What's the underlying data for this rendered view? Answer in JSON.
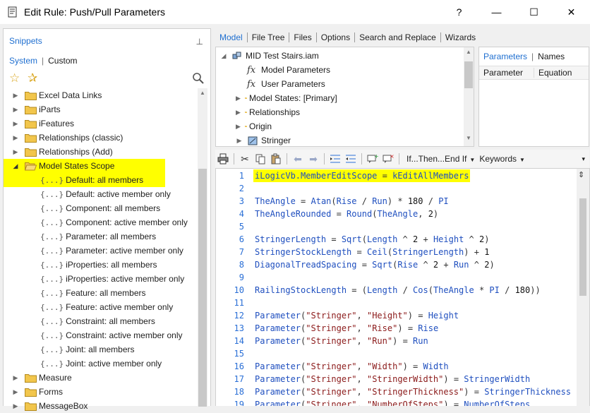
{
  "window": {
    "title": "Edit Rule: Push/Pull Parameters",
    "help_label": "?",
    "minimize_label": "—",
    "maximize_label": "☐",
    "close_label": "✕"
  },
  "snippets": {
    "header": "Snippets",
    "tab_system": "System",
    "tab_custom": "Custom",
    "items": [
      {
        "label": "Excel Data Links",
        "type": "folder",
        "expanded": false
      },
      {
        "label": "iParts",
        "type": "folder",
        "expanded": false
      },
      {
        "label": "iFeatures",
        "type": "folder",
        "expanded": false
      },
      {
        "label": "Relationships (classic)",
        "type": "folder",
        "expanded": false
      },
      {
        "label": "Relationships (Add)",
        "type": "folder",
        "expanded": false
      },
      {
        "label": "Model States Scope",
        "type": "folder",
        "expanded": true,
        "highlighted": true
      },
      {
        "label": "Default: all members",
        "type": "snippet",
        "highlighted": true
      },
      {
        "label": "Default: active member only",
        "type": "snippet"
      },
      {
        "label": "Component: all members",
        "type": "snippet"
      },
      {
        "label": "Component: active member only",
        "type": "snippet"
      },
      {
        "label": "Parameter: all members",
        "type": "snippet"
      },
      {
        "label": "Parameter: active member only",
        "type": "snippet"
      },
      {
        "label": "iProperties: all members",
        "type": "snippet"
      },
      {
        "label": "iProperties: active member only",
        "type": "snippet"
      },
      {
        "label": "Feature: all members",
        "type": "snippet"
      },
      {
        "label": "Feature: active member only",
        "type": "snippet"
      },
      {
        "label": "Constraint: all members",
        "type": "snippet"
      },
      {
        "label": "Constraint: active member only",
        "type": "snippet"
      },
      {
        "label": "Joint: all members",
        "type": "snippet"
      },
      {
        "label": "Joint: active member only",
        "type": "snippet"
      },
      {
        "label": "Measure",
        "type": "folder",
        "expanded": false
      },
      {
        "label": "Forms",
        "type": "folder",
        "expanded": false
      },
      {
        "label": "MessageBox",
        "type": "folder",
        "expanded": false
      }
    ],
    "snippet_glyph": "{...}"
  },
  "tabs": [
    "Model",
    "File Tree",
    "Files",
    "Options",
    "Search and Replace",
    "Wizards"
  ],
  "model_tree": [
    {
      "label": "MID Test Stairs.iam",
      "icon": "assembly-icon",
      "expander": true,
      "indent": 0
    },
    {
      "label": "Model Parameters",
      "icon": "fx-icon",
      "expander": false,
      "indent": 1
    },
    {
      "label": "User Parameters",
      "icon": "fx-icon",
      "expander": false,
      "indent": 1
    },
    {
      "label": "Model States: [Primary]",
      "icon": "folder-icon",
      "expander": true,
      "indent": 1
    },
    {
      "label": "Relationships",
      "icon": "folder-icon",
      "expander": true,
      "indent": 1
    },
    {
      "label": "Origin",
      "icon": "folder-icon",
      "expander": true,
      "indent": 1
    },
    {
      "label": "Stringer",
      "icon": "part-icon",
      "expander": true,
      "indent": 1
    }
  ],
  "fx_glyph": "fx",
  "params_panel": {
    "tab_parameters": "Parameters",
    "tab_names": "Names",
    "col_parameter": "Parameter",
    "col_equation": "Equation"
  },
  "code_toolbar": {
    "if_then": "If...Then...End If",
    "keywords": "Keywords"
  },
  "code_lines": [
    {
      "n": "1",
      "text": "iLogicVb.MemberEditScope = kEditAllMembers",
      "highlighted": true
    },
    {
      "n": "2",
      "text": ""
    },
    {
      "n": "3",
      "text": "TheAngle = Atan(Rise / Run) * 180 / PI"
    },
    {
      "n": "4",
      "text": "TheAngleRounded = Round(TheAngle, 2)"
    },
    {
      "n": "5",
      "text": ""
    },
    {
      "n": "6",
      "text": "StringerLength = Sqrt(Length ^ 2 + Height ^ 2)"
    },
    {
      "n": "7",
      "text": "StringerStockLength = Ceil(StringerLength) + 1"
    },
    {
      "n": "8",
      "text": "DiagonalTreadSpacing = Sqrt(Rise ^ 2 + Run ^ 2)"
    },
    {
      "n": "9",
      "text": ""
    },
    {
      "n": "10",
      "text": "RailingStockLength = (Length / Cos(TheAngle * PI / 180))"
    },
    {
      "n": "11",
      "text": ""
    },
    {
      "n": "12",
      "text": "Parameter(\"Stringer\", \"Height\") = Height"
    },
    {
      "n": "13",
      "text": "Parameter(\"Stringer\", \"Rise\") = Rise"
    },
    {
      "n": "14",
      "text": "Parameter(\"Stringer\", \"Run\") = Run"
    },
    {
      "n": "15",
      "text": ""
    },
    {
      "n": "16",
      "text": "Parameter(\"Stringer\", \"Width\") = Width"
    },
    {
      "n": "17",
      "text": "Parameter(\"Stringer\", \"StringerWidth\") = StringerWidth"
    },
    {
      "n": "18",
      "text": "Parameter(\"Stringer\", \"StringerThickness\") = StringerThickness"
    },
    {
      "n": "19",
      "text": "Parameter(\"Stringer\", \"NumberOfSteps\") = NumberOfSteps"
    }
  ],
  "colors": {
    "accent": "#1f6fd0",
    "highlight": "#ffff00",
    "code_identifier": "#1f4fbf",
    "code_string": "#8b1a1a",
    "line_number": "#2a6fd6",
    "folder": "#f2c64c"
  }
}
